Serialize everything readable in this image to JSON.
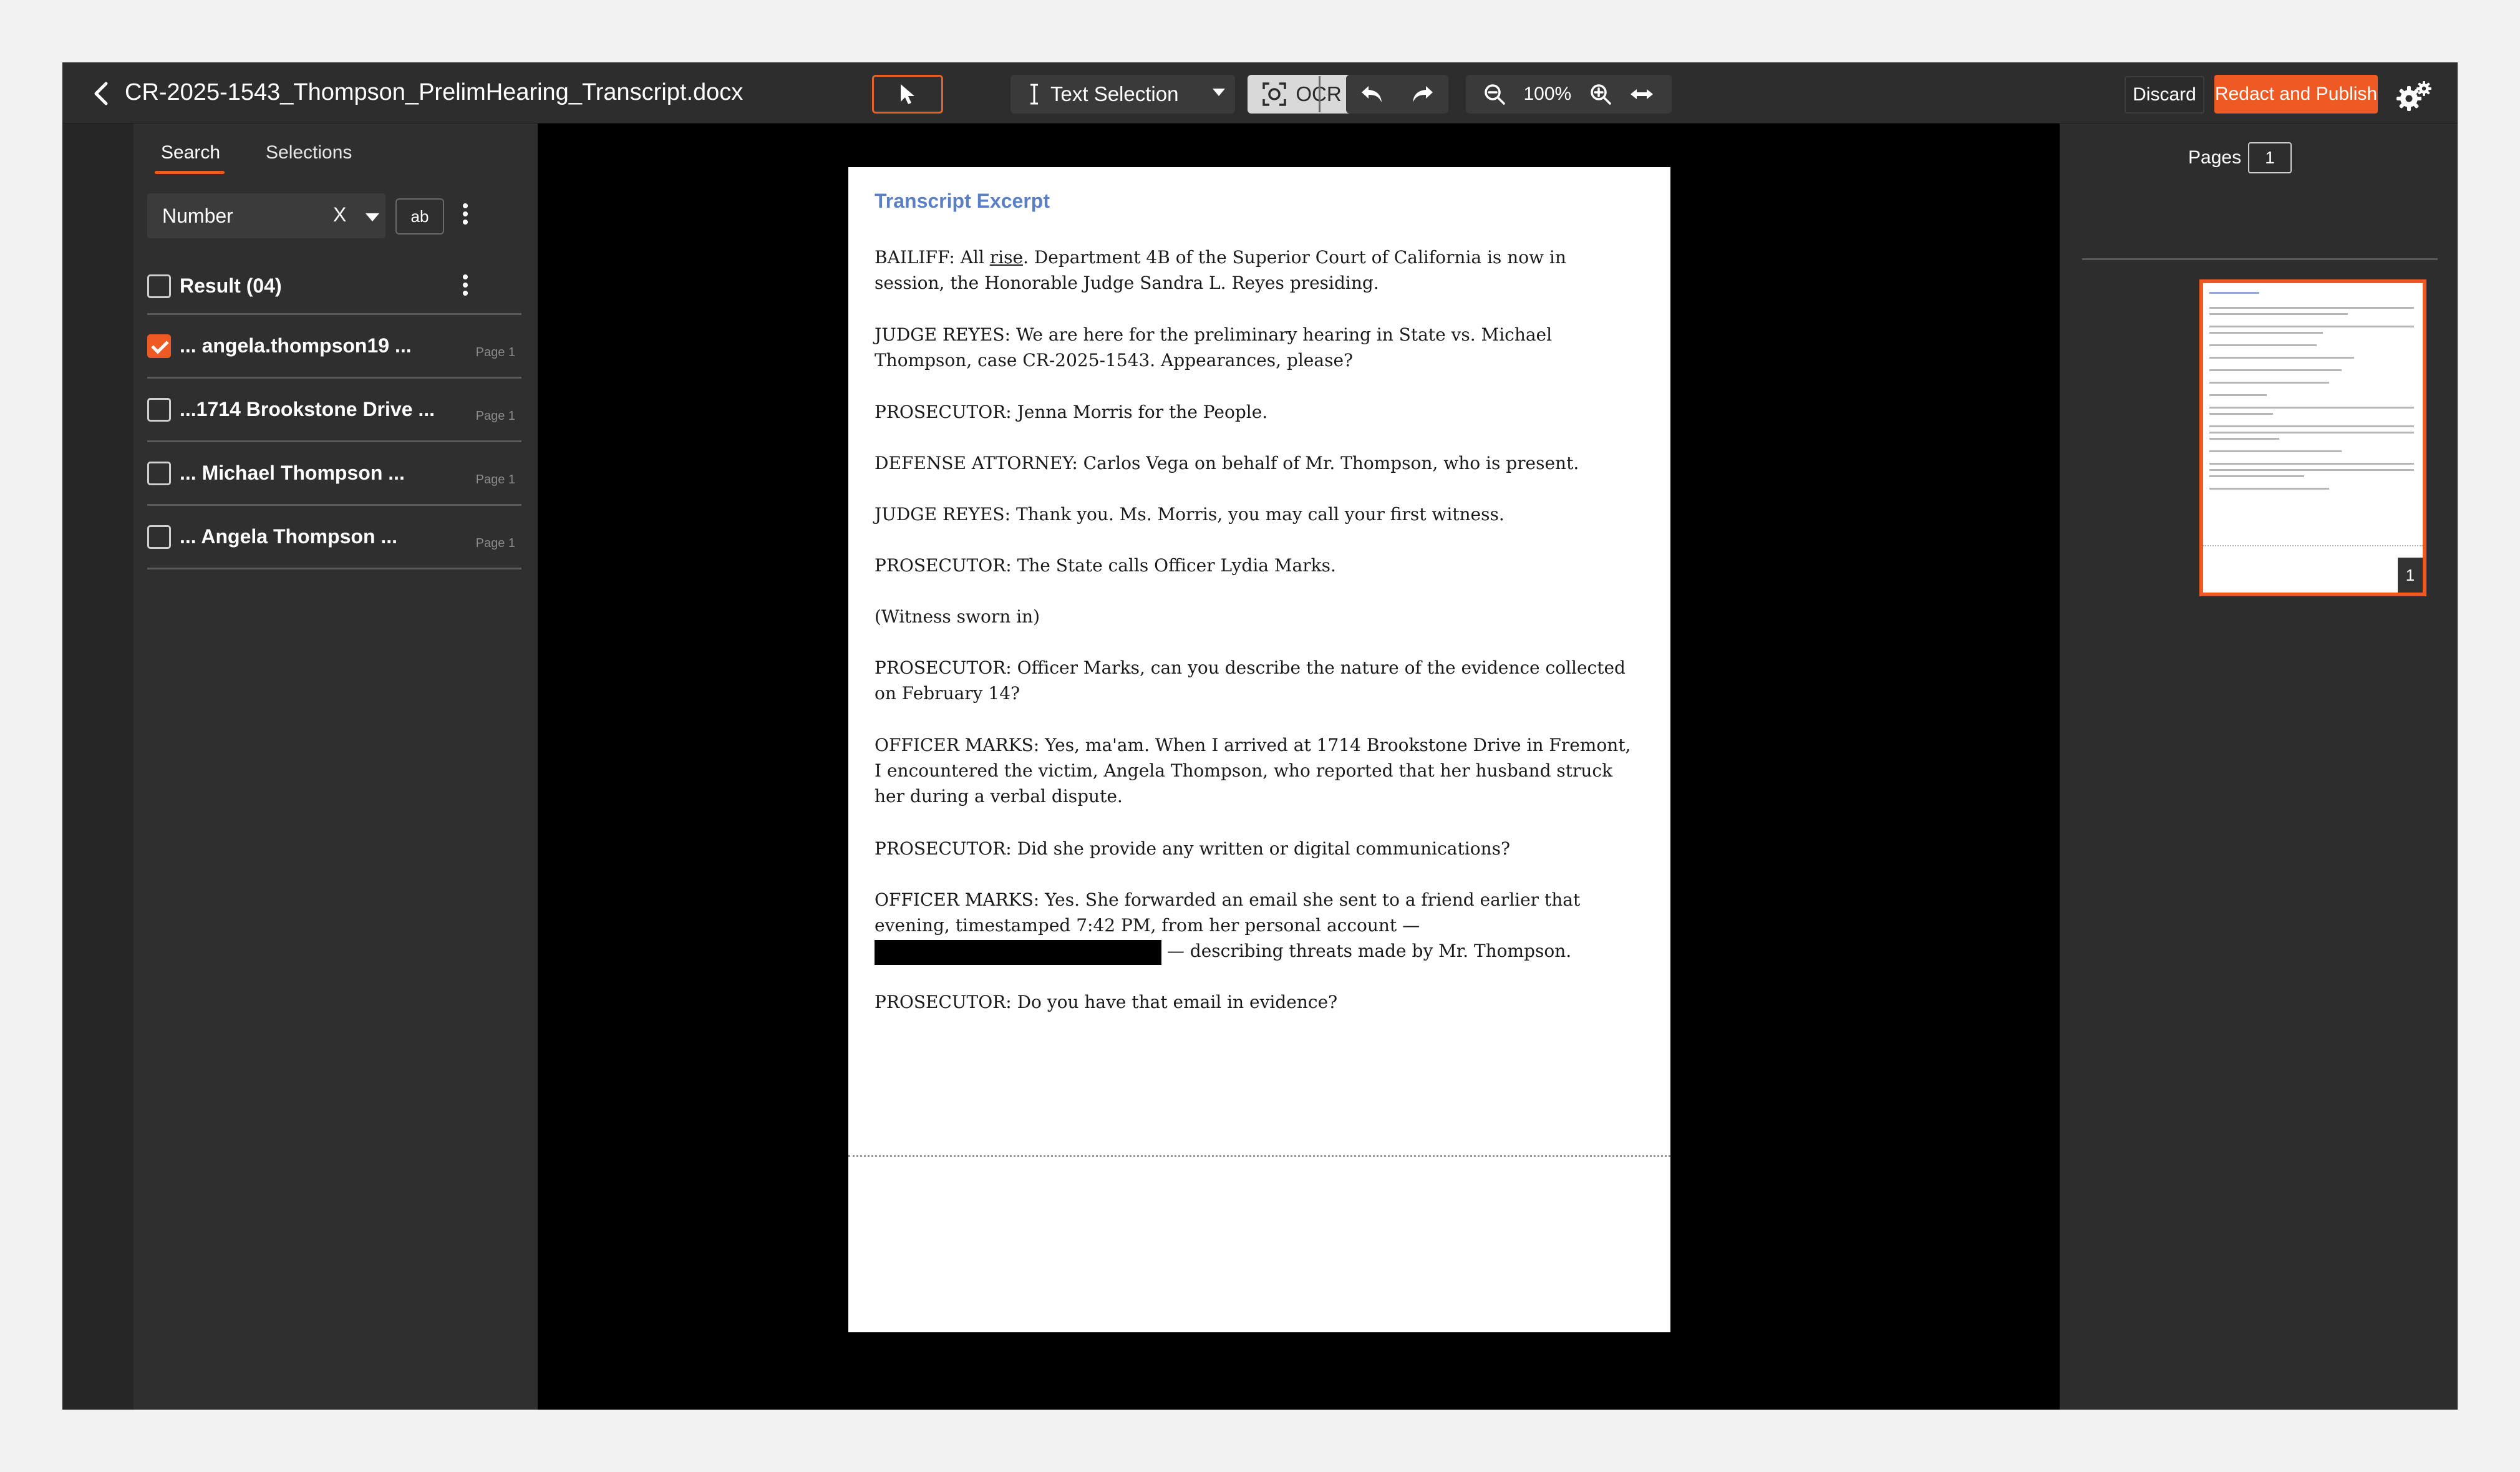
{
  "header": {
    "title": "CR-2025-1543_Thompson_PrelimHearing_Transcript.docx",
    "text_selection_label": "Text Selection",
    "ocr_label": "OCR",
    "zoom_level": "100%",
    "discard_label": "Discard",
    "publish_label": "Redact and Publish"
  },
  "left_panel": {
    "tabs": [
      {
        "label": "Search",
        "active": true
      },
      {
        "label": "Selections",
        "active": false
      }
    ],
    "search_type": "Number",
    "clear_label": "X",
    "match_case_label": "ab",
    "results_title": "Result (04)",
    "results": [
      {
        "text": "... angela.thompson19 ...",
        "page": "Page 1",
        "checked": true
      },
      {
        "text": "...1714 Brookstone Drive ...",
        "page": "Page 1",
        "checked": false
      },
      {
        "text": "... Michael Thompson ...",
        "page": "Page 1",
        "checked": false
      },
      {
        "text": "... Angela Thompson ...",
        "page": "Page 1",
        "checked": false
      }
    ]
  },
  "document": {
    "heading": "Transcript Excerpt",
    "p1_a": "BAILIFF: All ",
    "p1_u": "rise",
    "p1_b": ". Department 4B of the Superior Court of California is now in session, the Honorable Judge Sandra L. Reyes presiding.",
    "p2": "JUDGE REYES: We are here for the preliminary hearing in State vs. Michael Thompson, case CR-2025-1543. Appearances, please?",
    "p3": "PROSECUTOR: Jenna Morris for the People.",
    "p4": "DEFENSE ATTORNEY: Carlos Vega on behalf of Mr. Thompson, who is present.",
    "p5": "JUDGE REYES: Thank you. Ms. Morris, you may call your first witness.",
    "p6": "PROSECUTOR: The State calls Officer Lydia Marks.",
    "p7": "(Witness sworn in)",
    "p8": "PROSECUTOR: Officer Marks, can you describe the nature of the evidence collected on February 14?",
    "p9": "OFFICER MARKS: Yes, ma'am. When I arrived at 1714 Brookstone Drive in Fremont, I encountered the victim, Angela Thompson, who reported that her husband struck her during a verbal dispute.",
    "p10": "PROSECUTOR: Did she provide any written or digital communications?",
    "p11_a": "OFFICER MARKS: Yes. She forwarded an email she sent to a friend earlier that evening, timestamped 7:42 PM, from her personal account — ",
    "p11_b": " — describing threats made by Mr. Thompson.",
    "p12": "PROSECUTOR: Do you have that email in evidence?"
  },
  "right_panel": {
    "pages_label": "Pages",
    "current_page": "1",
    "thumbnail_number": "1"
  },
  "colors": {
    "accent": "#ef5a24",
    "heading_blue": "#5b7fc4"
  }
}
